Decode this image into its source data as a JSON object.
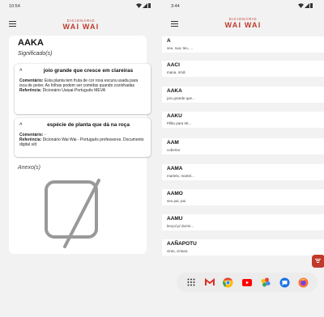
{
  "left": {
    "status_time": "10:54",
    "brand_top": "DICIONÁRIO",
    "brand_bottom": "WAI WAI",
    "word": "AAKA",
    "meaning_section_label": "Significado(s)",
    "meanings": [
      {
        "title": "joio grande que cresce em clareiras",
        "comment_label": "Comentário:",
        "comment": "Esta planta tem fruta de cor roxa escura usada para isca de peixe; As folhas podem ser comidas quando cozinhadas",
        "reference_label": "Referência:",
        "reference": "Dicionário Uaiuai-Português MEVA"
      },
      {
        "title": "espécie de planta que dá na roça",
        "comment_label": "Comentário:",
        "comment": "-",
        "reference_label": "Referência:",
        "reference": "Dicionário Wai Wai - Português professores. Documento digital s/d"
      }
    ],
    "attachments_label": "Anexo(s)"
  },
  "right": {
    "status_time": "3:44",
    "brand_top": "DICIONÁRIO",
    "brand_bottom": "WAI WAI",
    "entries": [
      {
        "word": "A",
        "def": "seu, sua, teu, ..."
      },
      {
        "word": "AACI",
        "def": "mana, irmã"
      },
      {
        "word": "AAKA",
        "def": "joio grande que..."
      },
      {
        "word": "AAKU",
        "def": "Pilão para trit..."
      },
      {
        "word": "AAM",
        "def": "cobertor"
      },
      {
        "word": "AAMA",
        "def": "martelo, martel..."
      },
      {
        "word": "AAMO",
        "def": "seu pai, pai"
      },
      {
        "word": "AAMU",
        "def": "lençol p/ dormi..."
      },
      {
        "word": "AAÑAPOTU",
        "def": "cinto, cintura"
      }
    ],
    "dock_apps": [
      "app-drawer-icon",
      "gmail-icon",
      "chrome-icon",
      "youtube-icon",
      "photos-icon",
      "messages-icon",
      "firefox-icon"
    ]
  },
  "colors": {
    "brand": "#c0392b",
    "background": "#f2f2f2",
    "card": "#ffffff"
  }
}
